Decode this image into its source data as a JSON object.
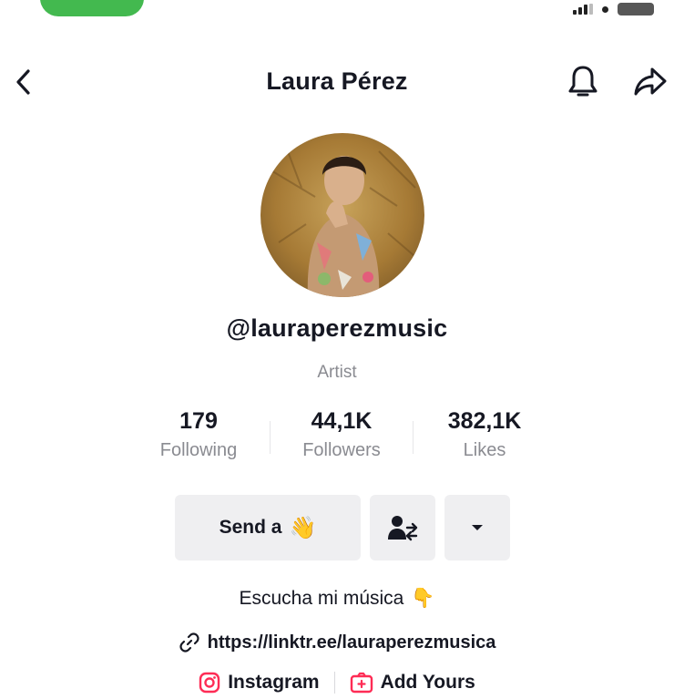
{
  "header": {
    "title": "Laura Pérez",
    "back_icon": "chevron-left-icon",
    "notification_icon": "bell-icon",
    "share_icon": "share-arrow-icon"
  },
  "profile": {
    "handle": "@lauraperezmusic",
    "role": "Artist"
  },
  "stats": [
    {
      "value": "179",
      "label": "Following"
    },
    {
      "value": "44,1K",
      "label": "Followers"
    },
    {
      "value": "382,1K",
      "label": "Likes"
    }
  ],
  "actions": {
    "send_label": "Send a",
    "send_icon": "👋",
    "friends_icon": "person-swap-icon",
    "more_icon": "caret-down-icon"
  },
  "bio": {
    "text": "Escucha mi música",
    "emoji": "👇"
  },
  "link": {
    "url": "https://linktr.ee/lauraperezmusica",
    "icon": "link-icon"
  },
  "social": {
    "instagram_label": "Instagram",
    "add_yours_label": "Add Yours"
  },
  "colors": {
    "accent": "#fe2c55",
    "text": "#161823",
    "muted": "#8a8b91",
    "button_bg": "#efeff1",
    "status_green": "#43b94f"
  }
}
